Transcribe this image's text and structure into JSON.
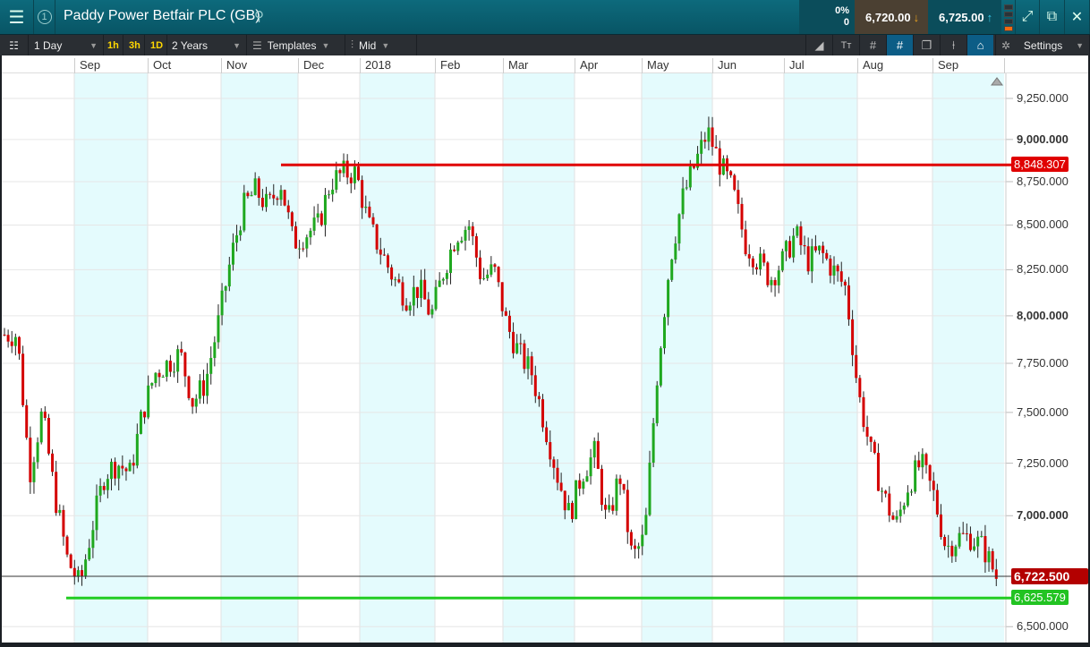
{
  "header": {
    "title": "Paddy Power Betfair PLC (GB)",
    "change_pct": "0%",
    "change_abs": "0",
    "sell": "6,720.00",
    "buy": "6,725.00",
    "badge": "1"
  },
  "toolbar": {
    "interval": "1 Day",
    "quick": [
      "1h",
      "3h",
      "1D"
    ],
    "range": "2 Years",
    "templates": "Templates",
    "price_type": "Mid",
    "settings": "Settings"
  },
  "chart_data": {
    "type": "candlestick",
    "instrument": "Paddy Power Betfair PLC (GB)",
    "months": [
      "Sep",
      "Oct",
      "Nov",
      "Dec",
      "2018",
      "Feb",
      "Mar",
      "Apr",
      "May",
      "Jun",
      "Jul",
      "Aug",
      "Sep"
    ],
    "y_ticks": [
      "9,250.000",
      "9,000.000",
      "8,750.000",
      "8,500.000",
      "8,250.000",
      "8,000.000",
      "7,750.000",
      "7,500.000",
      "7,250.000",
      "7,000.000",
      "6,500.000"
    ],
    "y_tick_values": [
      9250,
      9000,
      8750,
      8500,
      8250,
      8000,
      7750,
      7500,
      7250,
      7000,
      6500
    ],
    "ylim": [
      6500,
      9250
    ],
    "scale": "log",
    "approx_close_path": [
      7900,
      7900,
      7200,
      7500,
      7100,
      6800,
      6680,
      6950,
      7200,
      7250,
      7200,
      7500,
      7700,
      7750,
      7800,
      7550,
      7650,
      7950,
      8300,
      8600,
      8700,
      8600,
      8750,
      8400,
      8450,
      8500,
      8750,
      8800,
      8800,
      8500,
      8350,
      8200,
      8100,
      8150,
      8000,
      8250,
      8450,
      8500,
      8200,
      8250,
      7950,
      7800,
      7700,
      7450,
      7200,
      7000,
      7200,
      7300,
      6950,
      7200,
      6800,
      6900,
      7700,
      8300,
      8650,
      8850,
      9050,
      8850,
      8700,
      8400,
      8300,
      8200,
      8300,
      8450,
      8300,
      8350,
      8250,
      8150,
      7600,
      7300,
      7100,
      6950,
      7150,
      7250,
      7100,
      6850,
      6900,
      6900,
      6850,
      6720
    ],
    "resistance": {
      "value": 8848.307,
      "label": "8,848.307",
      "color": "#e00000"
    },
    "support": {
      "value": 6625.579,
      "label": "6,625.579",
      "color": "#22cc22"
    },
    "current": {
      "value": 6722.5,
      "label": "6,722.500",
      "color": "#b30000"
    },
    "up_color": "#1fa81f",
    "down_color": "#d40000"
  }
}
